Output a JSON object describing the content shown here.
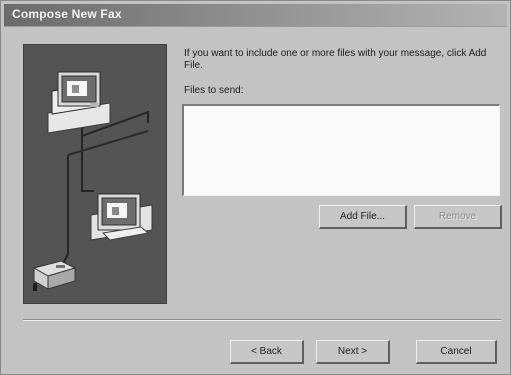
{
  "window": {
    "title": "Compose New Fax"
  },
  "page": {
    "instruction": "If you want to include one or more files with your message, click Add File.",
    "files_label": "Files to send:"
  },
  "buttons": {
    "add_file": "Add File...",
    "remove": "Remove",
    "back": "< Back",
    "next": "Next >",
    "cancel": "Cancel"
  },
  "state": {
    "remove_enabled": false,
    "files": []
  },
  "illustration": {
    "items": [
      "top-computer-icon",
      "bottom-computer-icon",
      "fax-machine-icon",
      "network-cable"
    ]
  }
}
